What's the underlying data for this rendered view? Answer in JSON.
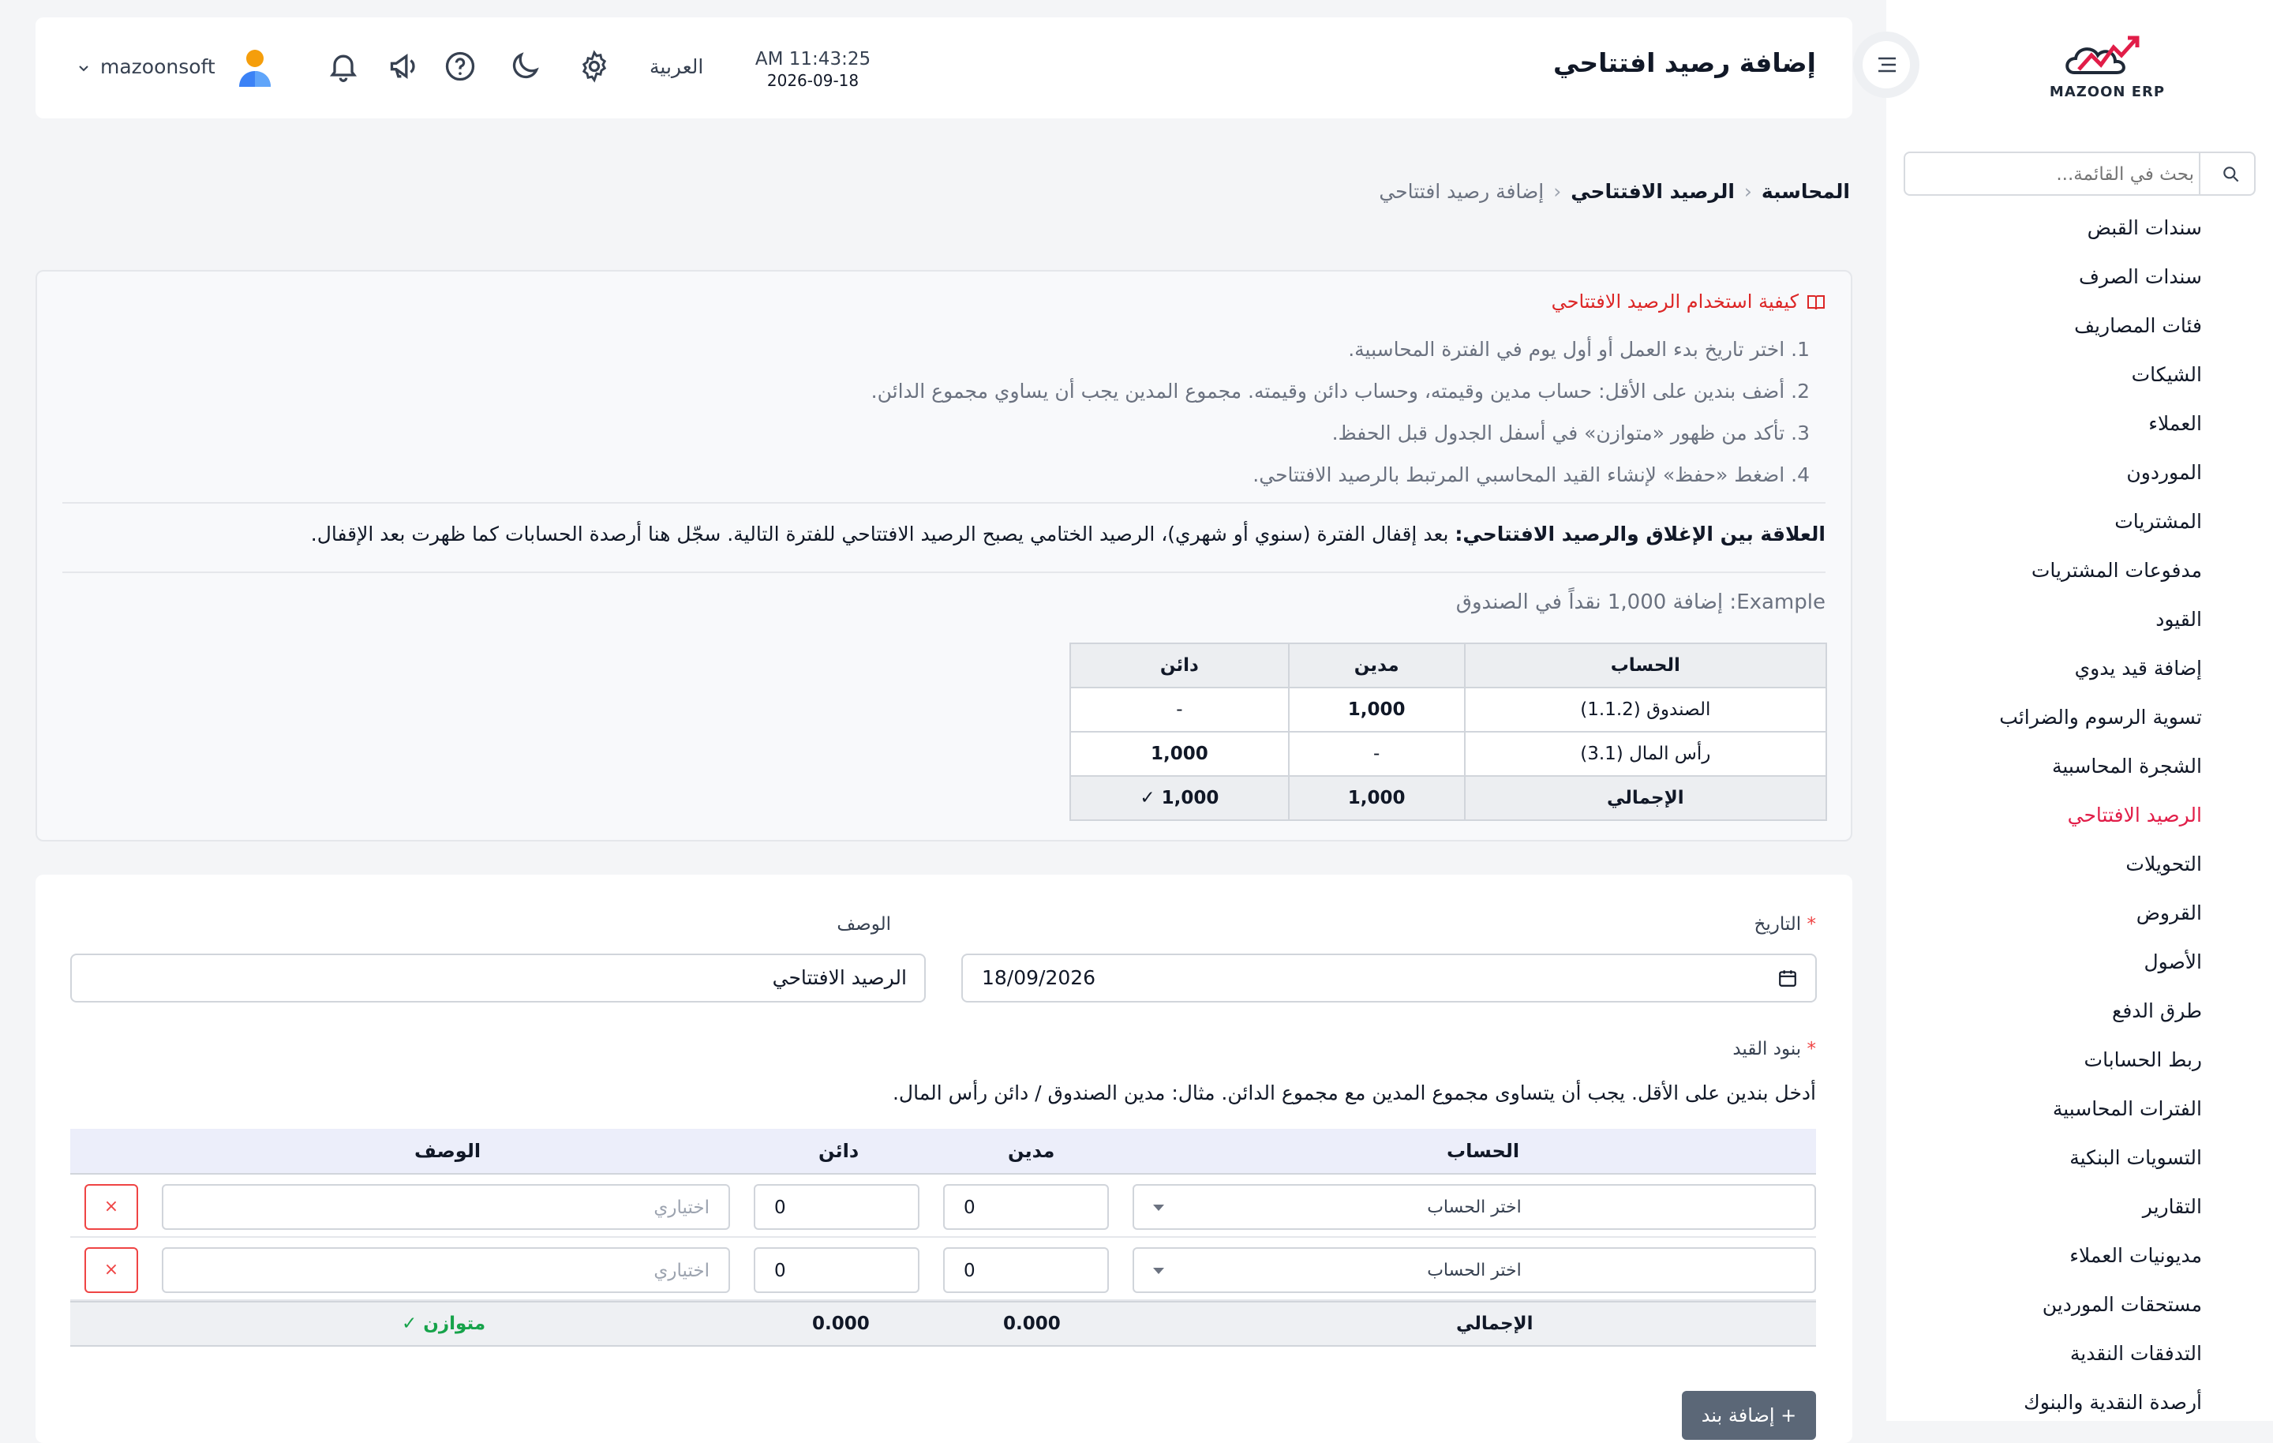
{
  "app": {
    "logo_text": "MAZOON ERP"
  },
  "sidebar": {
    "search_placeholder": "بحث في القائمة...",
    "items": [
      {
        "label": "سندات القبض"
      },
      {
        "label": "سندات الصرف"
      },
      {
        "label": "فئات المصاريف"
      },
      {
        "label": "الشيكات"
      },
      {
        "label": "العملاء"
      },
      {
        "label": "الموردون"
      },
      {
        "label": "المشتريات"
      },
      {
        "label": "مدفوعات المشتريات"
      },
      {
        "label": "القيود"
      },
      {
        "label": "إضافة قيد يدوي"
      },
      {
        "label": "تسوية الرسوم والضرائب"
      },
      {
        "label": "الشجرة المحاسبية"
      },
      {
        "label": "الرصيد الافتتاحي",
        "active": true
      },
      {
        "label": "التحويلات"
      },
      {
        "label": "القروض"
      },
      {
        "label": "الأصول"
      },
      {
        "label": "طرق الدفع"
      },
      {
        "label": "ربط الحسابات"
      },
      {
        "label": "الفترات المحاسبية"
      },
      {
        "label": "التسويات البنكية"
      },
      {
        "label": "التقارير"
      },
      {
        "label": "مديونيات العملاء"
      },
      {
        "label": "مستحقات الموردين"
      },
      {
        "label": "التدفقات النقدية"
      },
      {
        "label": "أرصدة النقدية والبنوك"
      }
    ]
  },
  "header": {
    "title": "إضافة رصيد افتتاحي",
    "time": "AM 11:43:25",
    "date": "2026-09-18",
    "language": "العربية",
    "username": "mazoonsoft"
  },
  "breadcrumb": {
    "level1": "المحاسبة",
    "level2": "الرصيد الافتتاحي",
    "level3": "إضافة رصيد افتتاحي"
  },
  "info": {
    "title": "كيفية استخدام الرصيد الافتتاحي",
    "steps": [
      "1. اختر تاريخ بدء العمل أو أول يوم في الفترة المحاسبية.",
      "2. أضف بندين على الأقل: حساب مدين وقيمته، وحساب دائن وقيمته. مجموع المدين يجب أن يساوي مجموع الدائن.",
      "3. تأكد من ظهور «متوازن» في أسفل الجدول قبل الحفظ.",
      "4. اضغط «حفظ» لإنشاء القيد المحاسبي المرتبط بالرصيد الافتتاحي."
    ],
    "relation_bold": "العلاقة بين الإغلاق والرصيد الافتتاحي:",
    "relation_text": " بعد إقفال الفترة (سنوي أو شهري)، الرصيد الختامي يصبح الرصيد الافتتاحي للفترة التالية. سجّل هنا أرصدة الحسابات كما ظهرت بعد الإقفال.",
    "example": "Example: إضافة 1,000 نقداً في الصندوق",
    "table": {
      "headers": {
        "account": "الحساب",
        "debit": "مدين",
        "credit": "دائن"
      },
      "rows": [
        {
          "account": "الصندوق (1.1.2)",
          "debit": "1,000",
          "credit": "-"
        },
        {
          "account": "رأس المال (3.1)",
          "debit": "-",
          "credit": "1,000"
        }
      ],
      "total": {
        "label": "الإجمالي",
        "debit": "1,000",
        "credit": "1,000 ✓"
      }
    }
  },
  "form": {
    "date_label": "التاريخ",
    "date_value": "18/09/2026",
    "desc_label": "الوصف",
    "desc_value": "الرصيد الافتتاحي",
    "lines_label": "بنود القيد",
    "hint": "أدخل بندين على الأقل. يجب أن يتساوى مجموع المدين مع مجموع الدائن. مثال: مدين الصندوق / دائن رأس المال.",
    "columns": {
      "account": "الحساب",
      "debit": "مدين",
      "credit": "دائن",
      "description": "الوصف"
    },
    "lines": [
      {
        "account_placeholder": "اختر الحساب",
        "debit": "0",
        "credit": "0",
        "desc_placeholder": "اختياري",
        "remove": "×"
      },
      {
        "account_placeholder": "اختر الحساب",
        "debit": "0",
        "credit": "0",
        "desc_placeholder": "اختياري",
        "remove": "×"
      }
    ],
    "total_label": "الإجمالي",
    "total_debit": "0.000",
    "total_credit": "0.000",
    "balanced": "✓ متوازن",
    "add_line": "+ إضافة بند"
  },
  "colors": {
    "accent_red": "#e11d48",
    "green": "#16a34a",
    "button": "#5b6777"
  }
}
